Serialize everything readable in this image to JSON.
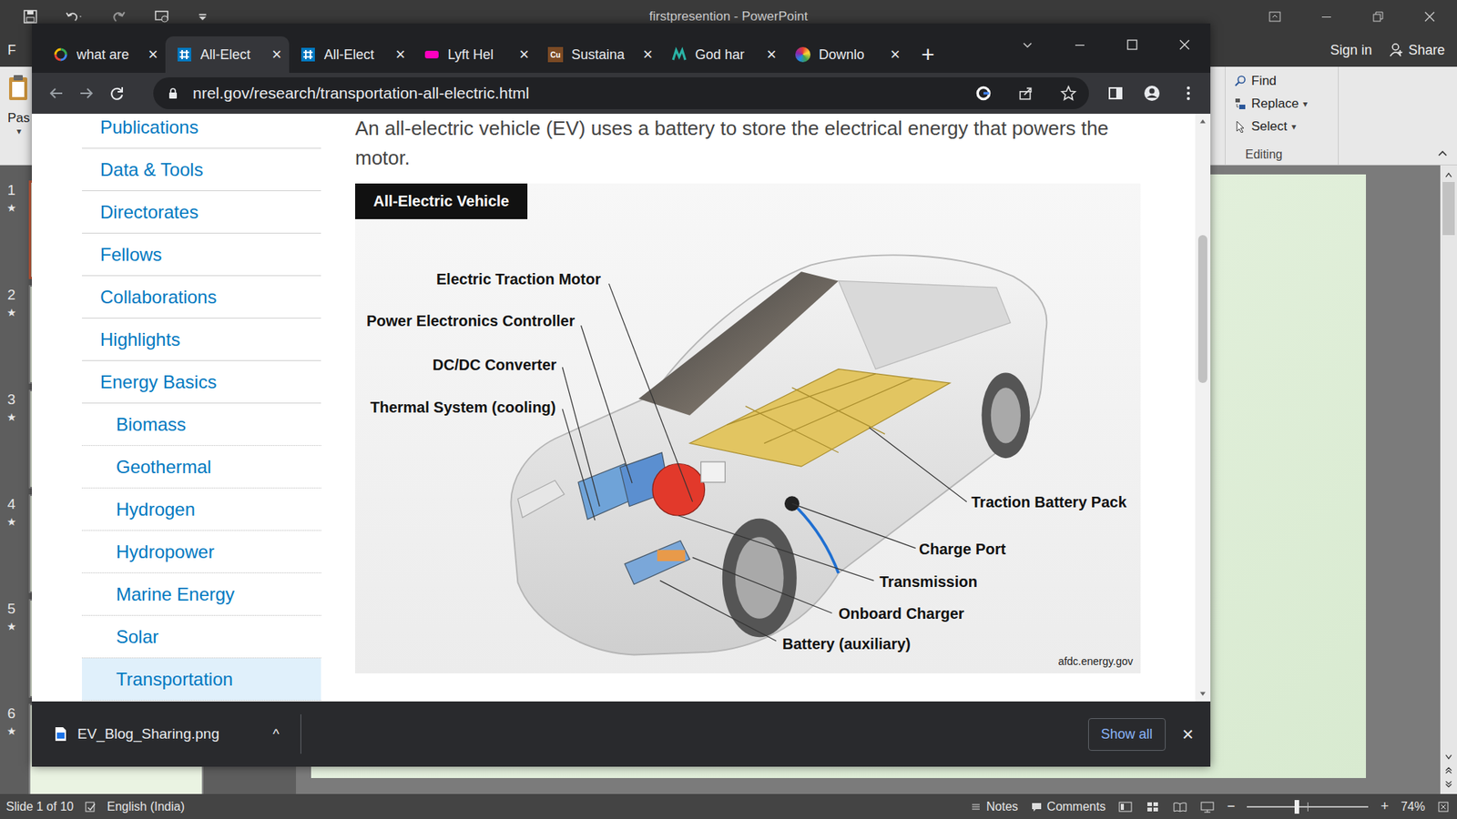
{
  "powerpoint": {
    "title": "firstpresention - PowerPoint",
    "file_tab": "F",
    "sign_in": "Sign in",
    "share": "Share",
    "paste": "Pas",
    "menu_glyph": "▾",
    "editing": {
      "group": "Editing",
      "items": [
        {
          "label": "Find",
          "has_menu": false
        },
        {
          "label": "Replace",
          "has_menu": true
        },
        {
          "label": "Select",
          "has_menu": true
        }
      ]
    },
    "star_glyph": "★",
    "slides": [
      {
        "number": "1",
        "animated": true,
        "selected": true
      },
      {
        "number": "2",
        "animated": true,
        "selected": false
      },
      {
        "number": "3",
        "animated": true,
        "selected": false
      },
      {
        "number": "4",
        "animated": true,
        "selected": false
      },
      {
        "number": "5",
        "animated": true,
        "selected": false
      },
      {
        "number": "6",
        "animated": true,
        "selected": false
      }
    ],
    "scroll_level": 0.0,
    "status_bar": {
      "slide": "Slide 1 of 10",
      "language": "English (India)",
      "notes": "Notes",
      "comments": "Comments",
      "zoom_out": "−",
      "zoom_in": "+",
      "zoom": "74%",
      "zoom_level": 0.41
    }
  },
  "browser": {
    "tabs": [
      {
        "label": "what are",
        "favicon": "google",
        "badge": "",
        "selected": false
      },
      {
        "label": "All-Elect",
        "favicon": "nrel",
        "badge": "",
        "selected": true
      },
      {
        "label": "All-Elect",
        "favicon": "nrel",
        "badge": "",
        "selected": false
      },
      {
        "label": "Lyft Hel",
        "favicon": "lyft",
        "badge": "",
        "selected": false
      },
      {
        "label": "Sustaina",
        "favicon": "cu",
        "badge": "Cu",
        "selected": false
      },
      {
        "label": "God har",
        "favicon": "m",
        "badge": "",
        "selected": false
      },
      {
        "label": "Downlo",
        "favicon": "color",
        "badge": "",
        "selected": false
      }
    ],
    "close_glyph": "×",
    "new_tab": "+",
    "url": "nrel.gov/research/transportation-all-electric.html",
    "sidebar": {
      "items": [
        {
          "label": "Publications",
          "indent": false,
          "selected": false
        },
        {
          "label": "Data & Tools",
          "indent": false,
          "selected": false
        },
        {
          "label": "Directorates",
          "indent": false,
          "selected": false
        },
        {
          "label": "Fellows",
          "indent": false,
          "selected": false
        },
        {
          "label": "Collaborations",
          "indent": false,
          "selected": false
        },
        {
          "label": "Highlights",
          "indent": false,
          "selected": false
        },
        {
          "label": "Energy Basics",
          "indent": false,
          "selected": false
        },
        {
          "label": "Biomass",
          "indent": true,
          "selected": false
        },
        {
          "label": "Geothermal",
          "indent": true,
          "selected": false
        },
        {
          "label": "Hydrogen",
          "indent": true,
          "selected": false
        },
        {
          "label": "Hydropower",
          "indent": true,
          "selected": false
        },
        {
          "label": "Marine Energy",
          "indent": true,
          "selected": false
        },
        {
          "label": "Solar",
          "indent": true,
          "selected": false
        },
        {
          "label": "Transportation",
          "indent": true,
          "selected": true
        }
      ]
    },
    "intro": "An all-electric vehicle (EV) uses a battery to store the electrical energy that powers the motor.",
    "figure": {
      "title": "All-Electric Vehicle",
      "labels": [
        "Electric Traction Motor",
        "Power Electronics Controller",
        "DC/DC Converter",
        "Thermal System (cooling)",
        "Traction Battery Pack",
        "Charge Port",
        "Transmission",
        "Onboard Charger",
        "Battery (auxiliary)"
      ],
      "credit": "afdc.energy.gov"
    },
    "scroll_level": 0.19,
    "download": {
      "file": "EV_Blog_Sharing.png",
      "caret": "^",
      "show_all": "Show all",
      "close": "×"
    }
  }
}
